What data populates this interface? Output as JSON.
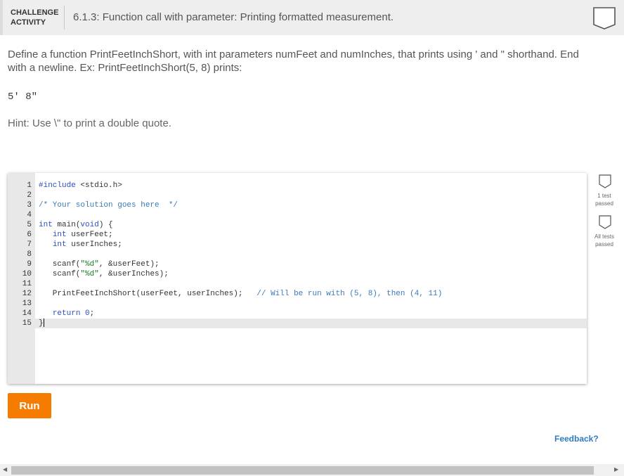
{
  "header": {
    "activity_line1": "CHALLENGE",
    "activity_line2": "ACTIVITY",
    "title": "6.1.3: Function call with parameter: Printing formatted measurement."
  },
  "description": "Define a function PrintFeetInchShort, with int parameters numFeet and numInches, that prints using ' and \" shorthand. End with a newline. Ex: PrintFeetInchShort(5, 8) prints:",
  "example_output": "5' 8\"",
  "hint": "Hint: Use \\\" to print a double quote.",
  "editor": {
    "lines": [
      {
        "n": "1",
        "code": "#include <stdio.h>"
      },
      {
        "n": "2",
        "code": ""
      },
      {
        "n": "3",
        "code": "/* Your solution goes here  */"
      },
      {
        "n": "4",
        "code": ""
      },
      {
        "n": "5",
        "code": "int main(void) {"
      },
      {
        "n": "6",
        "code": "   int userFeet;"
      },
      {
        "n": "7",
        "code": "   int userInches;"
      },
      {
        "n": "8",
        "code": ""
      },
      {
        "n": "9",
        "code": "   scanf(\"%d\", &userFeet);"
      },
      {
        "n": "10",
        "code": "   scanf(\"%d\", &userInches);"
      },
      {
        "n": "11",
        "code": ""
      },
      {
        "n": "12",
        "code": "   PrintFeetInchShort(userFeet, userInches);   // Will be run with (5, 8), then (4, 11)"
      },
      {
        "n": "13",
        "code": ""
      },
      {
        "n": "14",
        "code": "   return 0;"
      },
      {
        "n": "15",
        "code": "}"
      }
    ]
  },
  "tests": {
    "first": "1 test passed",
    "first_line1": "1 test",
    "first_line2": "passed",
    "all_line1": "All tests",
    "all_line2": "passed"
  },
  "run_label": "Run",
  "feedback_label": "Feedback?",
  "colors": {
    "accent": "#f57c00",
    "link": "#2d7cc1",
    "keyword": "#2b4fbf",
    "string": "#1a7a1a",
    "comment": "#3c7ab8"
  },
  "icons": [
    "shield-icon",
    "test-shield-icon",
    "scroll-left-arrow-icon",
    "scroll-right-arrow-icon"
  ]
}
